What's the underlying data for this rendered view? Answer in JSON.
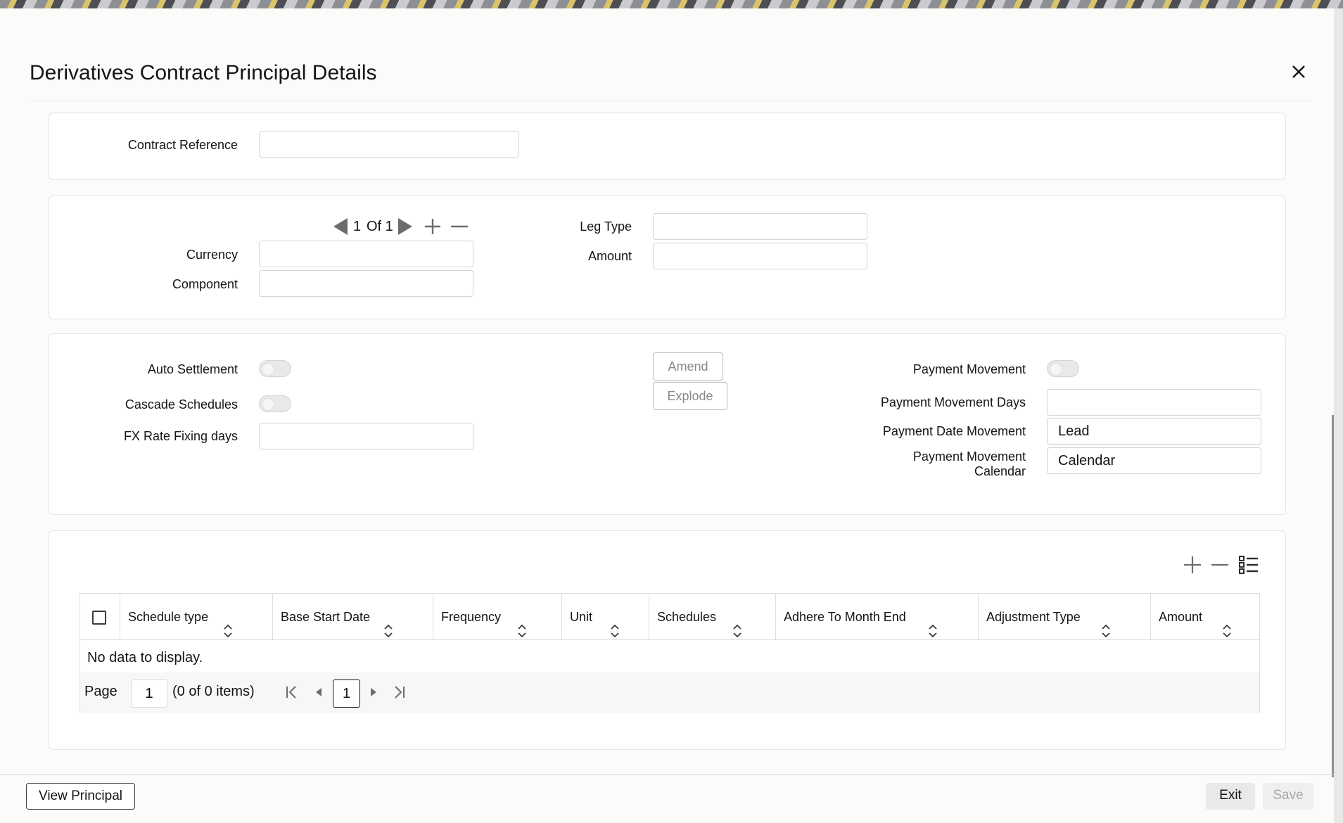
{
  "dialog": {
    "title": "Derivatives Contract Principal Details",
    "close_icon": "close-icon"
  },
  "contract": {
    "reference_label": "Contract Reference",
    "reference_value": ""
  },
  "legs": {
    "pager_current": "1",
    "pager_of": "Of 1",
    "currency_label": "Currency",
    "currency_value": "",
    "component_label": "Component",
    "component_value": "",
    "leg_type_label": "Leg Type",
    "leg_type_value": "",
    "amount_label": "Amount",
    "amount_value": ""
  },
  "settlement": {
    "auto_settlement_label": "Auto Settlement",
    "auto_settlement_on": false,
    "cascade_label": "Cascade Schedules",
    "cascade_on": false,
    "fx_days_label": "FX Rate Fixing days",
    "fx_days_value": "",
    "amend_label": "Amend",
    "explode_label": "Explode",
    "payment_movement_label": "Payment Movement",
    "payment_movement_on": false,
    "payment_movement_days_label": "Payment Movement Days",
    "payment_movement_days_value": "",
    "payment_date_movement_label": "Payment Date Movement",
    "payment_date_movement_value": "Lead",
    "payment_movement_calendar_label_1": "Payment Movement",
    "payment_movement_calendar_label_2": "Calendar",
    "payment_movement_calendar_value": "Calendar"
  },
  "schedules": {
    "columns": [
      "Schedule type",
      "Base Start Date",
      "Frequency",
      "Unit",
      "Schedules",
      "Adhere To Month End",
      "Adjustment Type",
      "Amount"
    ],
    "no_data": "No data to display.",
    "page_label": "Page",
    "page_value": "1",
    "items_text": "(0 of 0 items)",
    "current_page": "1"
  },
  "footer": {
    "view_principal": "View Principal",
    "exit": "Exit",
    "save": "Save"
  }
}
